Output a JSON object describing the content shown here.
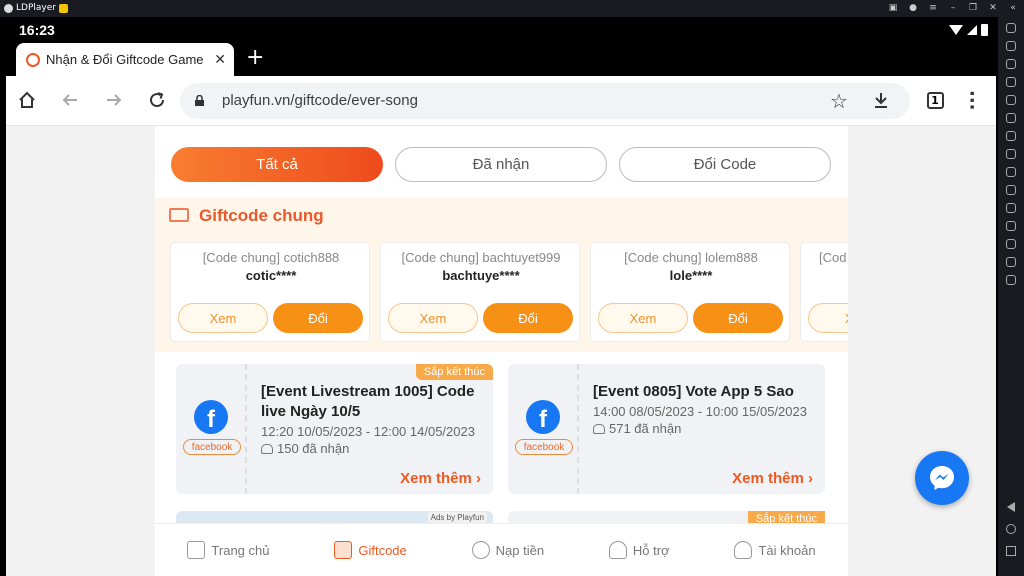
{
  "ldplayer": {
    "title": "LDPlayer"
  },
  "status": {
    "time": "16:23"
  },
  "tab": {
    "title": "Nhận & Đổi Giftcode Game Ever Song"
  },
  "omnibox": {
    "url": "playfun.vn/giftcode/ever-song",
    "tab_count": "1"
  },
  "filters": {
    "all": "Tất cả",
    "received": "Đã nhận",
    "redeem": "Đổi Code"
  },
  "giftcode": {
    "heading": "Giftcode chung",
    "cards": [
      {
        "name": "[Code chung] cotich888",
        "code": "cotic****",
        "view": "Xem",
        "redeem": "Đổi"
      },
      {
        "name": "[Code chung] bachtuyet999",
        "code": "bachtuye****",
        "view": "Xem",
        "redeem": "Đổi"
      },
      {
        "name": "[Code chung] lolem888",
        "code": "lole****",
        "view": "Xem",
        "redeem": "Đổi"
      },
      {
        "name": "[Cod",
        "code": "",
        "view": "Xe",
        "redeem": ""
      }
    ]
  },
  "events": [
    {
      "title": "[Event Livestream 1005] Code live Ngày 10/5",
      "time": "12:20 10/05/2023 - 12:00 14/05/2023",
      "count": "150 đã nhận",
      "more": "Xem thêm",
      "badge": "Sắp kết thúc",
      "platform": "facebook"
    },
    {
      "title": "[Event 0805] Vote App 5 Sao",
      "time": "14:00 08/05/2023 - 10:00 15/05/2023",
      "count": "571 đã nhận",
      "more": "Xem thêm",
      "badge": "",
      "platform": "facebook"
    }
  ],
  "peek": {
    "ads": "Ads by Playfun",
    "badge": "Sắp kết thúc"
  },
  "bottomnav": [
    {
      "label": "Trang chủ",
      "icon": "home-icon"
    },
    {
      "label": "Giftcode",
      "icon": "gift-icon"
    },
    {
      "label": "Nạp tiền",
      "icon": "coins-icon"
    },
    {
      "label": "Hỗ trợ",
      "icon": "headset-icon"
    },
    {
      "label": "Tài khoản",
      "icon": "user-icon"
    }
  ],
  "colors": {
    "accent": "#ee5a20",
    "orange": "#f79115",
    "facebook": "#1877f2"
  }
}
